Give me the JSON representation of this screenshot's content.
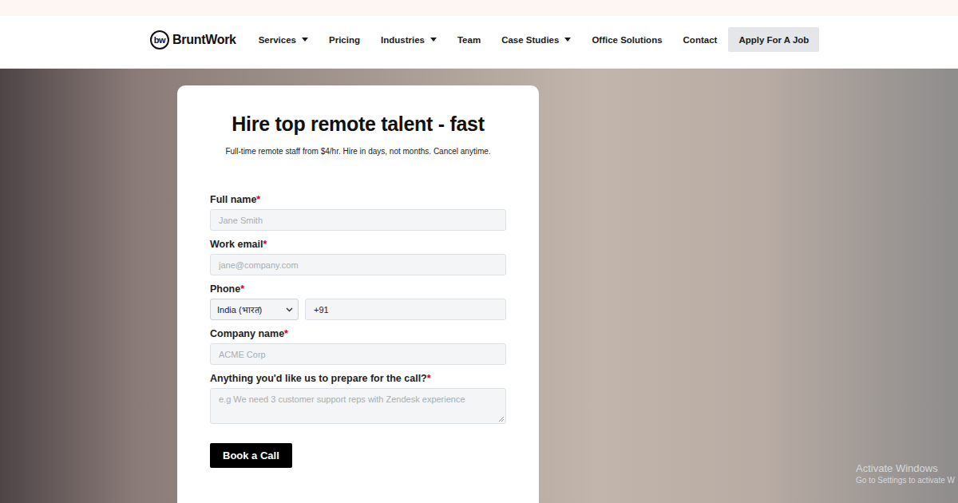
{
  "logo": {
    "mark": "bw",
    "name": "BruntWork"
  },
  "nav": {
    "items": [
      {
        "label": "Services",
        "dropdown": true
      },
      {
        "label": "Pricing",
        "dropdown": false
      },
      {
        "label": "Industries",
        "dropdown": true
      },
      {
        "label": "Team",
        "dropdown": false
      },
      {
        "label": "Case Studies",
        "dropdown": true
      },
      {
        "label": "Office Solutions",
        "dropdown": false
      },
      {
        "label": "Contact",
        "dropdown": false
      }
    ],
    "cta": "Apply For A Job"
  },
  "form": {
    "title": "Hire top remote talent - fast",
    "subtitle": "Full-time remote staff from $4/hr. Hire in days, not months. Cancel anytime.",
    "required_mark": "*",
    "fields": [
      {
        "kind": "text",
        "label": "Full name",
        "required": true,
        "placeholder": "Jane Smith"
      },
      {
        "kind": "text",
        "label": "Work email",
        "required": true,
        "placeholder": "jane@company.com"
      },
      {
        "kind": "phone",
        "label": "Phone",
        "required": true,
        "country": "India (भारत)",
        "value": "+91"
      },
      {
        "kind": "text",
        "label": "Company name",
        "required": true,
        "placeholder": "ACME Corp"
      },
      {
        "kind": "textarea",
        "label": "Anything you'd like us to prepare for the call?",
        "required": true,
        "placeholder": "e.g We need 3 customer support reps with Zendesk experience"
      }
    ],
    "submit": "Book a Call"
  },
  "watermark": {
    "title": "Activate Windows",
    "subtitle": "Go to Settings to activate W"
  }
}
